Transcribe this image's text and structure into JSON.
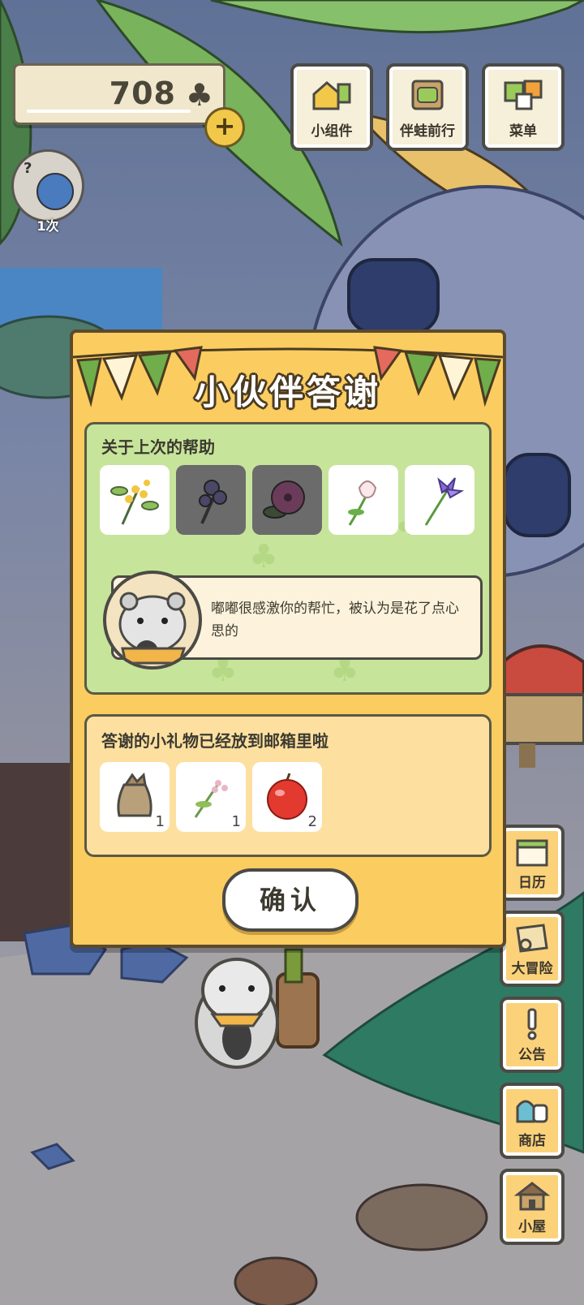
{
  "currency": {
    "amount": "708",
    "plus": "+"
  },
  "top_buttons": [
    {
      "label": "小组件",
      "icon": "widget-icon"
    },
    {
      "label": "伴蛙前行",
      "icon": "frog-journey-icon"
    },
    {
      "label": "菜单",
      "icon": "menu-icon"
    }
  ],
  "visitor": {
    "count": "1次",
    "question": "?"
  },
  "dialog": {
    "title": "小伙伴答谢",
    "help_heading": "关于上次的帮助",
    "flowers": [
      {
        "icon": "osmanthus-icon",
        "dim": false
      },
      {
        "icon": "pansy-icon",
        "dim": true
      },
      {
        "icon": "hibiscus-icon",
        "dim": true
      },
      {
        "icon": "tulip-icon",
        "dim": false
      },
      {
        "icon": "iris-icon",
        "dim": false
      }
    ],
    "message": "嘟嘟很感激你的帮忙，被认为是花了点心思的",
    "gift_heading": "答谢的小礼物已经放到邮箱里啦",
    "gifts": [
      {
        "icon": "seed-bag-icon",
        "count": "1"
      },
      {
        "icon": "lavender-sprig-icon",
        "count": "1"
      },
      {
        "icon": "apple-icon",
        "count": "2"
      }
    ],
    "confirm_label": "确认"
  },
  "side_buttons": [
    {
      "label": "日历",
      "icon": "calendar-icon"
    },
    {
      "label": "大冒险",
      "icon": "adventure-map-icon"
    },
    {
      "label": "公告",
      "icon": "notice-icon"
    },
    {
      "label": "商店",
      "icon": "shop-icon"
    },
    {
      "label": "小屋",
      "icon": "house-icon"
    }
  ],
  "colors": {
    "dialog_bg": "#fbcc60",
    "help_panel": "#c7e49b",
    "gift_panel": "#fde0a0",
    "outline": "#4c4a45"
  }
}
